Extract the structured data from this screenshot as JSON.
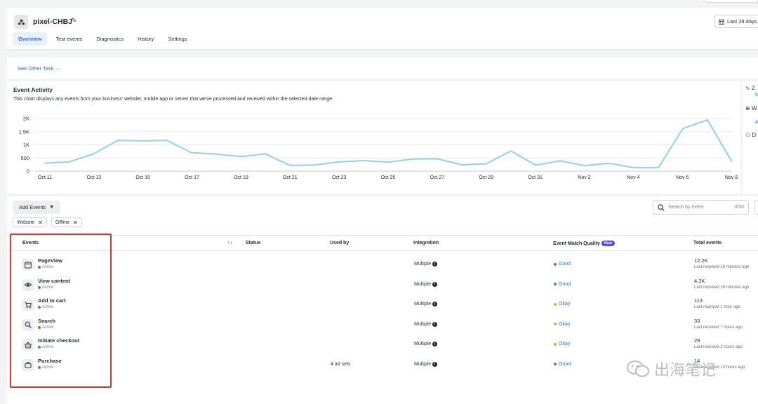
{
  "header": {
    "pixel_name": "pixel-CHBJ",
    "date_range": "Last 28 days",
    "tabs": [
      {
        "label": "Overview"
      },
      {
        "label": "Test events"
      },
      {
        "label": "Diagnostics"
      },
      {
        "label": "History"
      },
      {
        "label": "Settings"
      }
    ],
    "active_tab": "Overview"
  },
  "tasks": {
    "link": "See Other Task →"
  },
  "activity": {
    "title": "Event Activity",
    "description": "This chart displays any events from your business' website, mobile app or server that we've processed and received within the selected date range."
  },
  "side_panel": {
    "row1": "2",
    "row1_sub": "N",
    "row2": "W",
    "row2_sub": "4",
    "row3": "D"
  },
  "chart_data": {
    "type": "line",
    "x_tick_labels": [
      "Oct 11",
      "Oct 13",
      "Oct 15",
      "Oct 17",
      "Oct 19",
      "Oct 21",
      "Oct 23",
      "Oct 25",
      "Oct 27",
      "Oct 29",
      "Oct 31",
      "Nov 2",
      "Nov 4",
      "Nov 6",
      "Nov 8"
    ],
    "y_tick_labels": [
      "2K",
      "1.5K",
      "1K",
      "500",
      "0"
    ],
    "ylim": [
      0,
      2000
    ],
    "grid": true,
    "color": "#8fd0f2",
    "series": [
      {
        "values": [
          300,
          350,
          650,
          1170,
          1150,
          1170,
          700,
          650,
          550,
          660,
          220,
          230,
          350,
          400,
          340,
          460,
          470,
          240,
          280,
          770,
          230,
          390,
          210,
          300,
          130,
          130,
          1620,
          1950,
          350
        ]
      }
    ]
  },
  "controls": {
    "add_events_label": "Add Events",
    "search_placeholder": "Search by event",
    "search_count": "0/50",
    "filters": [
      "Website",
      "Offline"
    ]
  },
  "table": {
    "headers": {
      "events": "Events",
      "sort": "↑↓",
      "status": "Status",
      "used_by": "Used by",
      "integration": "Integration",
      "quality": "Event Match Quality",
      "quality_badge": "New",
      "total": "Total events"
    },
    "rows": [
      {
        "name": "PageView",
        "icon": "browser-window-icon",
        "status": "Active",
        "used_by": "",
        "integration": "Multiple",
        "quality": "Good",
        "quality_color": "#31a24c",
        "total": "12.2K",
        "last": "Last received 16 minutes ago"
      },
      {
        "name": "View content",
        "icon": "eye-icon",
        "status": "Active",
        "used_by": "",
        "integration": "Multiple",
        "quality": "Good",
        "quality_color": "#31a24c",
        "total": "4.3K",
        "last": "Last received 16 minutes ago"
      },
      {
        "name": "Add to cart",
        "icon": "cart-icon",
        "status": "Active",
        "used_by": "",
        "integration": "Multiple",
        "quality": "Okay",
        "quality_color": "#f2a33a",
        "total": "113",
        "last": "Last received 1 hour ago"
      },
      {
        "name": "Search",
        "icon": "search-icon",
        "status": "Active",
        "used_by": "",
        "integration": "Multiple",
        "quality": "Okay",
        "quality_color": "#f2a33a",
        "total": "33",
        "last": "Last received 7 hours ago"
      },
      {
        "name": "Initiate checkout",
        "icon": "basket-icon",
        "status": "Active",
        "used_by": "",
        "integration": "Multiple",
        "quality": "Okay",
        "quality_color": "#f2a33a",
        "total": "29",
        "last": "Last received 2 hours ago"
      },
      {
        "name": "Purchase",
        "icon": "bag-icon",
        "status": "Active",
        "used_by": "4 ad sets",
        "integration": "Multiple",
        "quality": "Good",
        "quality_color": "#31a24c",
        "total": "14",
        "last": "Last received 10 hours ago"
      }
    ]
  },
  "watermark": {
    "text": "出海笔记"
  }
}
